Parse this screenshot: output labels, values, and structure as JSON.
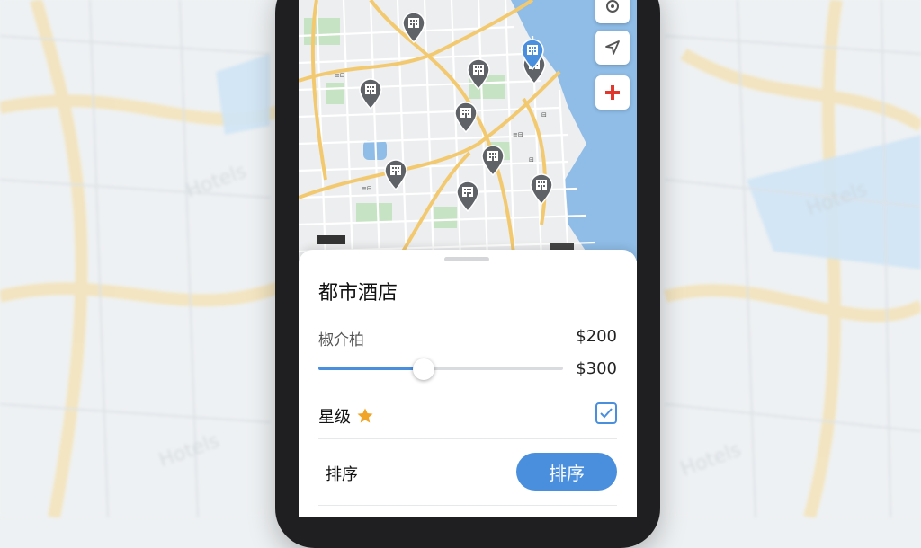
{
  "sheet": {
    "title": "都市酒店",
    "price_label": "椒介柏",
    "price_min": "$200",
    "price_max": "$300",
    "price_position": 0.43,
    "star_label": "星级",
    "star_checked": true,
    "sort_label": "排序",
    "sort_button": "排序"
  },
  "map": {
    "icons": [
      "gear-icon",
      "navigate-arrow-icon",
      "hospital-icon"
    ],
    "pins": [
      "hotel-pin",
      "hotel-pin",
      "hotel-pin",
      "hotel-pin",
      "hotel-pin",
      "hotel-pin",
      "hotel-pin",
      "hotel-pin",
      "hotel-pin",
      "hotel-pin-selected"
    ]
  },
  "colors": {
    "accent": "#4a8fde",
    "pin": "#5f6368",
    "water": "#8fbde7",
    "road": "#f3c970",
    "star": "#f0a529"
  }
}
